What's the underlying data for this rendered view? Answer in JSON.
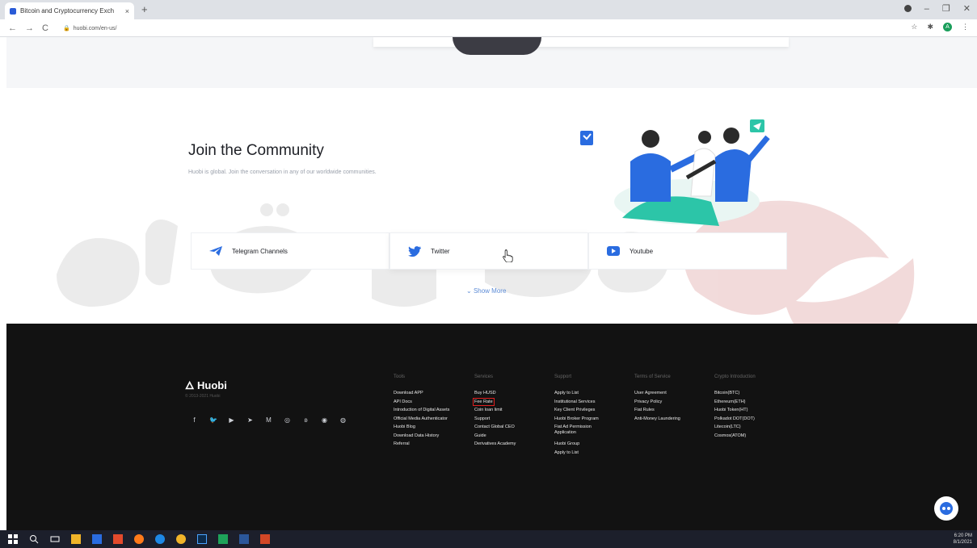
{
  "browser": {
    "tab_title": "Bitcoin and Cryptocurrency Exch",
    "tab_close": "×",
    "new_tab": "+",
    "url": "huobi.com/en-us/",
    "back": "←",
    "forward": "→",
    "reload": "C"
  },
  "community": {
    "title": "Join the Community",
    "description": "Huobi is global. Join the conversation in any of our worldwide communities.",
    "channels": [
      {
        "label": "Telegram Channels",
        "icon": "telegram-icon"
      },
      {
        "label": "Twitter",
        "icon": "twitter-icon"
      },
      {
        "label": "Youtube",
        "icon": "youtube-icon"
      }
    ],
    "show_more": "Show More"
  },
  "footer": {
    "brand": "Huobi",
    "copyright": "© 2013-2021 Huobi",
    "columns": [
      {
        "title": "Tools",
        "links": [
          "Download APP",
          "API Docs",
          "Introduction of Digital Assets",
          "Official Media Authenticator",
          "Huobi Blog",
          "Download Data History",
          "Referral"
        ]
      },
      {
        "title": "Services",
        "links": [
          "Buy HUSD",
          "Fee Rate",
          "Coin loan limit",
          "Support",
          "Contact Global CEO",
          "Guide",
          "Derivatives Academy"
        ]
      },
      {
        "title": "Support",
        "links": [
          "Apply to List",
          "Institutional Services",
          "Key Client Privileges",
          "Huobi Broker Program",
          "Fiat Ad Permission Application",
          "Huobi Group",
          "Apply to List"
        ]
      },
      {
        "title": "Terms of Service",
        "links": [
          "User Agreement",
          "Privacy Policy",
          "Fiat Rules",
          "Anti-Money Laundering"
        ]
      },
      {
        "title": "Crypto Introduction",
        "links": [
          "Bitcoin(BTC)",
          "Ethereum(ETH)",
          "Huobi Token(HT)",
          "Polkadot DOT(DOT)",
          "Litecoin(LTC)",
          "Cosmos(ATOM)"
        ]
      }
    ],
    "highlighted_link": "Fee Rate"
  },
  "taskbar": {
    "time": "6:20 PM",
    "date": "8/1/2021"
  },
  "colors": {
    "accent_blue": "#2a6ce0",
    "teal": "#2cc5a8",
    "footer_bg": "#121212",
    "highlight_red": "#e02020"
  }
}
